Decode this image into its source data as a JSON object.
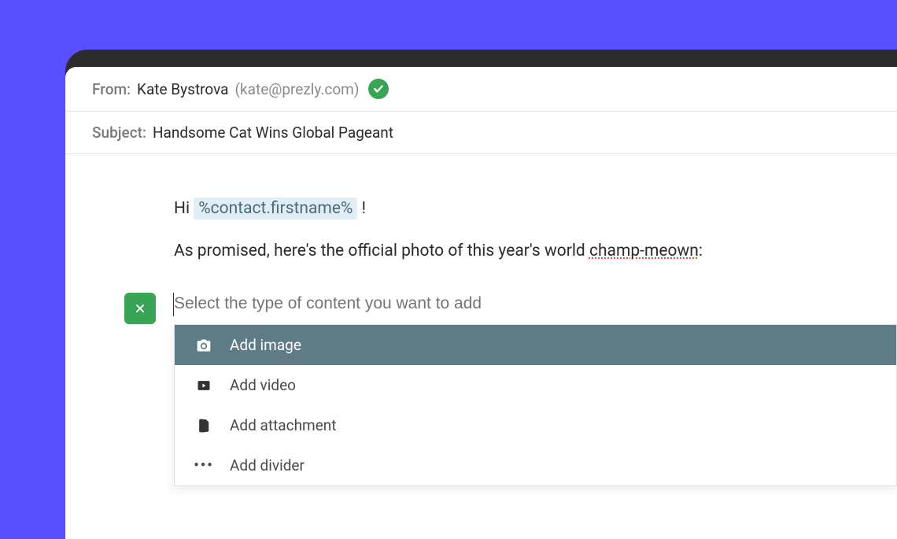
{
  "header": {
    "from_label": "From:",
    "from_name": "Kate Bystrova",
    "from_email": "(kate@prezly.com)",
    "subject_label": "Subject:",
    "subject_value": "Handsome Cat Wins Global Pageant"
  },
  "body": {
    "greeting_prefix": "Hi ",
    "merge_tag": "%contact.firstname%",
    "greeting_suffix": " !",
    "line2_prefix": "As promised, here's the official photo of this year's world ",
    "line2_spellcheck": "champ-meown",
    "line2_suffix": ":"
  },
  "insert": {
    "placeholder": "Select the type of content you want to add",
    "options": [
      {
        "label": "Add image",
        "icon": "camera-icon",
        "selected": true
      },
      {
        "label": "Add video",
        "icon": "play-icon",
        "selected": false
      },
      {
        "label": "Add attachment",
        "icon": "document-icon",
        "selected": false
      },
      {
        "label": "Add divider",
        "icon": "dots-icon",
        "selected": false
      }
    ]
  }
}
